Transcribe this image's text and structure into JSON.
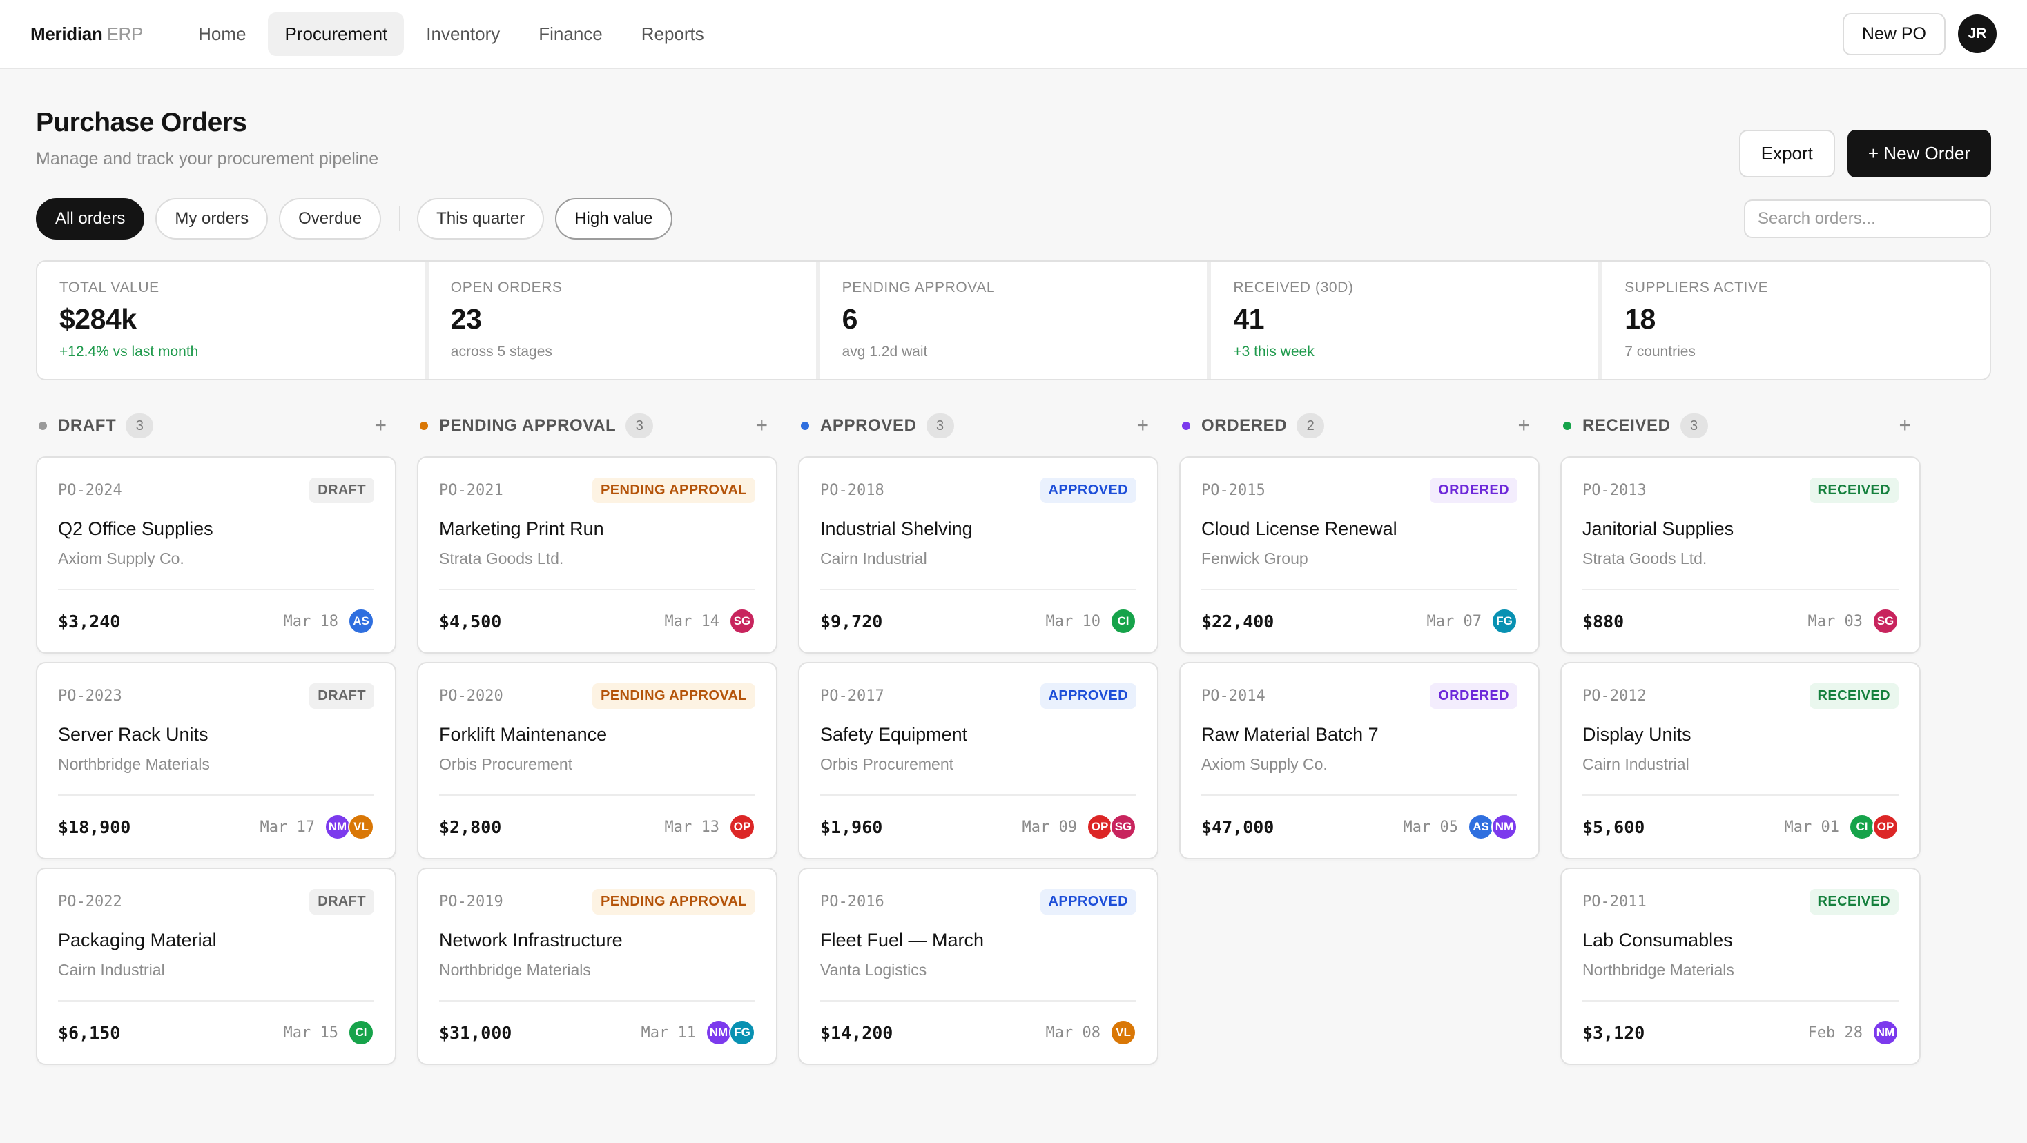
{
  "app": {
    "brand": "Meridian",
    "brand_sub": "ERP"
  },
  "nav": [
    {
      "label": "Home"
    },
    {
      "label": "Procurement",
      "active": true
    },
    {
      "label": "Inventory"
    },
    {
      "label": "Finance"
    },
    {
      "label": "Reports"
    }
  ],
  "topbar": {
    "new_po_label": "New PO",
    "user_initials": "JR"
  },
  "page": {
    "title": "Purchase Orders",
    "subtitle": "Manage and track your procurement pipeline",
    "export_label": "Export",
    "new_order_label": "+ New Order"
  },
  "filters": {
    "chips": [
      {
        "label": "All orders",
        "state": "active"
      },
      {
        "label": "My orders",
        "state": "default"
      },
      {
        "label": "Overdue",
        "state": "default"
      },
      {
        "label": "This quarter",
        "state": "default"
      },
      {
        "label": "High value",
        "state": "strong"
      }
    ],
    "search_placeholder": "Search orders..."
  },
  "stats": [
    {
      "label": "TOTAL VALUE",
      "value": "$284k",
      "note": "+12.4% vs last month",
      "positive": true
    },
    {
      "label": "OPEN ORDERS",
      "value": "23",
      "note": "across 5 stages",
      "positive": false
    },
    {
      "label": "PENDING APPROVAL",
      "value": "6",
      "note": "avg 1.2d wait",
      "positive": false
    },
    {
      "label": "RECEIVED (30D)",
      "value": "41",
      "note": "+3 this week",
      "positive": true
    },
    {
      "label": "SUPPLIERS ACTIVE",
      "value": "18",
      "note": "7 countries",
      "positive": false
    }
  ],
  "avatar_colors": {
    "AS": "#2f6fdf",
    "NM": "#7c3aed",
    "VL": "#d97706",
    "CI": "#16a34a",
    "SG": "#c8245d",
    "OP": "#dc2626",
    "FG": "#0891b2"
  },
  "columns": [
    {
      "title": "DRAFT",
      "count": "3",
      "dot": "#9a9a9a",
      "badge": {
        "text": "DRAFT",
        "fg": "#666666",
        "bg": "#f0f0f0"
      },
      "cards": [
        {
          "po": "PO-2024",
          "title": "Q2 Office Supplies",
          "supplier": "Axiom Supply Co.",
          "amount": "$3,240",
          "date": "Mar 18",
          "avatars": [
            "AS"
          ]
        },
        {
          "po": "PO-2023",
          "title": "Server Rack Units",
          "supplier": "Northbridge Materials",
          "amount": "$18,900",
          "date": "Mar 17",
          "avatars": [
            "NM",
            "VL"
          ]
        },
        {
          "po": "PO-2022",
          "title": "Packaging Material",
          "supplier": "Cairn Industrial",
          "amount": "$6,150",
          "date": "Mar 15",
          "avatars": [
            "CI"
          ]
        }
      ]
    },
    {
      "title": "PENDING APPROVAL",
      "count": "3",
      "dot": "#d97706",
      "badge": {
        "text": "PENDING APPROVAL",
        "fg": "#b45309",
        "bg": "#fdf3e3"
      },
      "cards": [
        {
          "po": "PO-2021",
          "title": "Marketing Print Run",
          "supplier": "Strata Goods Ltd.",
          "amount": "$4,500",
          "date": "Mar 14",
          "avatars": [
            "SG"
          ]
        },
        {
          "po": "PO-2020",
          "title": "Forklift Maintenance",
          "supplier": "Orbis Procurement",
          "amount": "$2,800",
          "date": "Mar 13",
          "avatars": [
            "OP"
          ]
        },
        {
          "po": "PO-2019",
          "title": "Network Infrastructure",
          "supplier": "Northbridge Materials",
          "amount": "$31,000",
          "date": "Mar 11",
          "avatars": [
            "NM",
            "FG"
          ]
        }
      ]
    },
    {
      "title": "APPROVED",
      "count": "3",
      "dot": "#2f6fdf",
      "badge": {
        "text": "APPROVED",
        "fg": "#1d4ed8",
        "bg": "#eaf1fd"
      },
      "cards": [
        {
          "po": "PO-2018",
          "title": "Industrial Shelving",
          "supplier": "Cairn Industrial",
          "amount": "$9,720",
          "date": "Mar 10",
          "avatars": [
            "CI"
          ]
        },
        {
          "po": "PO-2017",
          "title": "Safety Equipment",
          "supplier": "Orbis Procurement",
          "amount": "$1,960",
          "date": "Mar 09",
          "avatars": [
            "OP",
            "SG"
          ]
        },
        {
          "po": "PO-2016",
          "title": "Fleet Fuel — March",
          "supplier": "Vanta Logistics",
          "amount": "$14,200",
          "date": "Mar 08",
          "avatars": [
            "VL"
          ]
        }
      ]
    },
    {
      "title": "ORDERED",
      "count": "2",
      "dot": "#7c3aed",
      "badge": {
        "text": "ORDERED",
        "fg": "#6d28d9",
        "bg": "#f3edfd"
      },
      "cards": [
        {
          "po": "PO-2015",
          "title": "Cloud License Renewal",
          "supplier": "Fenwick Group",
          "amount": "$22,400",
          "date": "Mar 07",
          "avatars": [
            "FG"
          ]
        },
        {
          "po": "PO-2014",
          "title": "Raw Material Batch 7",
          "supplier": "Axiom Supply Co.",
          "amount": "$47,000",
          "date": "Mar 05",
          "avatars": [
            "AS",
            "NM"
          ]
        }
      ]
    },
    {
      "title": "RECEIVED",
      "count": "3",
      "dot": "#16a34a",
      "badge": {
        "text": "RECEIVED",
        "fg": "#15803d",
        "bg": "#eaf7ee"
      },
      "cards": [
        {
          "po": "PO-2013",
          "title": "Janitorial Supplies",
          "supplier": "Strata Goods Ltd.",
          "amount": "$880",
          "date": "Mar 03",
          "avatars": [
            "SG"
          ]
        },
        {
          "po": "PO-2012",
          "title": "Display Units",
          "supplier": "Cairn Industrial",
          "amount": "$5,600",
          "date": "Mar 01",
          "avatars": [
            "CI",
            "OP"
          ]
        },
        {
          "po": "PO-2011",
          "title": "Lab Consumables",
          "supplier": "Northbridge Materials",
          "amount": "$3,120",
          "date": "Feb 28",
          "avatars": [
            "NM"
          ]
        }
      ]
    }
  ]
}
